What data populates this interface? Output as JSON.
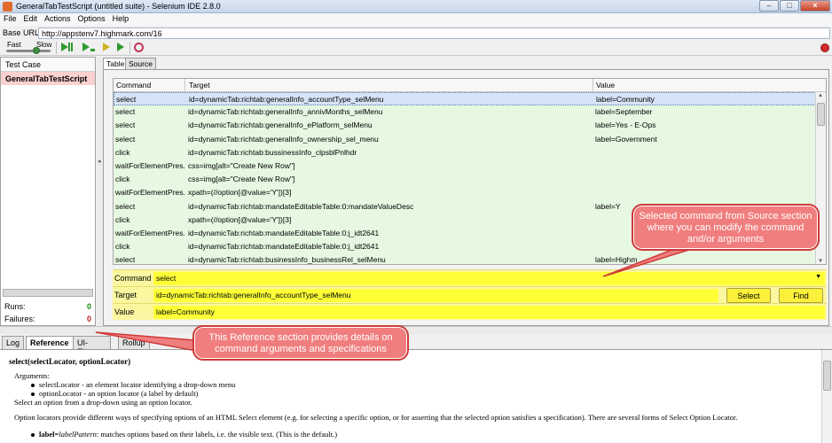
{
  "window": {
    "title": "GeneralTabTestScript (untitled suite) - Selenium IDE 2.8.0"
  },
  "menu": [
    "File",
    "Edit",
    "Actions",
    "Options",
    "Help"
  ],
  "base_url": {
    "label": "Base URL",
    "value": "http://appstenv7.highmark.com/16"
  },
  "toolbar": {
    "fast_label": "Fast",
    "slow_label": "Slow"
  },
  "left": {
    "header": "Test Case",
    "item": "GeneralTabTestScript",
    "runs_label": "Runs:",
    "runs_value": "0",
    "failures_label": "Failures:",
    "failures_value": "0"
  },
  "tabs": [
    "Table",
    "Source"
  ],
  "grid": {
    "columns": [
      "Command",
      "Target",
      "Value"
    ],
    "rows": [
      [
        "select",
        "id=dynamicTab:richtab:generalInfo_accountType_selMenu",
        "label=Community"
      ],
      [
        "select",
        "id=dynamicTab:richtab:generalInfo_annivMonths_selMenu",
        "label=September"
      ],
      [
        "select",
        "id=dynamicTab:richtab:generalInfo_ePlatform_selMenu",
        "label=Yes - E-Ops"
      ],
      [
        "select",
        "id=dynamicTab:richtab:generalInfo_ownership_sel_menu",
        "label=Government"
      ],
      [
        "click",
        "id=dynamicTab:richtab:bussinessInfo_clpsblPnlhdr",
        ""
      ],
      [
        "waitForElementPres...",
        "css=img[alt=\"Create New Row\"]",
        ""
      ],
      [
        "click",
        "css=img[alt=\"Create New Row\"]",
        ""
      ],
      [
        "waitForElementPres...",
        "xpath=(//option[@value='Y'])[3]",
        ""
      ],
      [
        "select",
        "id=dynamicTab:richtab:mandateEditableTable:0:mandateValueDesc",
        "label=Y"
      ],
      [
        "click",
        "xpath=(//option[@value='Y'])[3]",
        ""
      ],
      [
        "waitForElementPres...",
        "id=dynamicTab:richtab:mandateEditableTable:0:j_idt2641",
        ""
      ],
      [
        "click",
        "id=dynamicTab:richtab:mandateEditableTable:0:j_idt2641",
        ""
      ],
      [
        "select",
        "id=dynamicTab:richtab:businessInfo_businessRel_selMenu",
        "label=Highm"
      ]
    ]
  },
  "editor": {
    "command_label": "Command",
    "command_value": "select",
    "target_label": "Target",
    "target_value": "id=dynamicTab:richtab:generalInfo_accountType_selMenu",
    "value_label": "Value",
    "value_value": "label=Community",
    "select_button": "Select",
    "find_button": "Find"
  },
  "bottom_tabs": [
    "Log",
    "Reference",
    "UI-Element",
    "Rollup"
  ],
  "reference": {
    "signature": "select(selectLocator, optionLocator)",
    "arguments_label": "Arguments:",
    "args": [
      "selectLocator - an element locator identifying a drop-down menu",
      "optionLocator - an option locator (a label by default)"
    ],
    "desc": "Select an option from a drop-down using an option locator.",
    "para": "Option locators provide different ways of specifying options of an HTML Select element (e.g. for selecting a specific option, or for asserting that the selected option satisfies a specification). There are several forms of Select Option Locator.",
    "label_bold": "label=",
    "label_italic": "labelPattern",
    "label_rest": ": matches options based on their labels, i.e. the visible text. (This is the default.)"
  },
  "callouts": {
    "source": "Selected command from Source section where you can modify the command and/or arguments",
    "reference": "This Reference section provides details on command arguments and specifications"
  },
  "colors": {
    "row_bg": "#e6f8e2",
    "selected_row_bg": "#d5e4f6",
    "editor_bg": "#fbf7a0",
    "callout_bg": "#f07e7e",
    "callout_border": "#cf3a3a",
    "test_item_bg": "#fbd0d0"
  }
}
